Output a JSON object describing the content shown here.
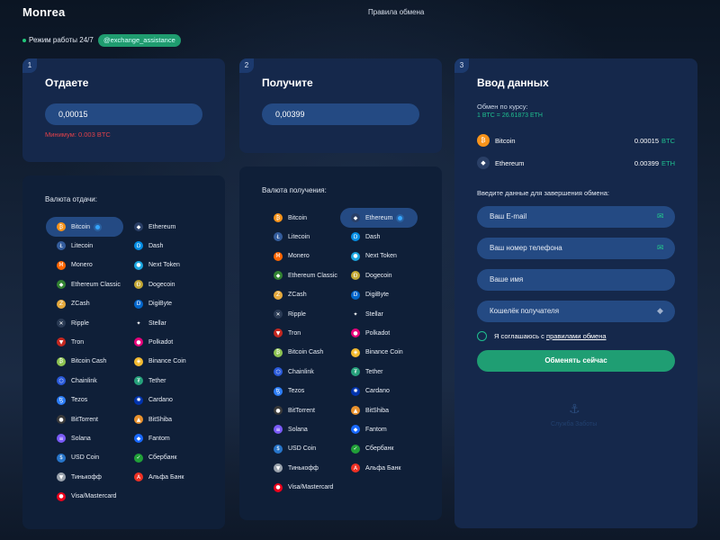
{
  "header": {
    "brand": "Monrea",
    "nav": "Правила обмена"
  },
  "status": {
    "text": "Режим работы 24/7",
    "telegram": "@exchange_assistance"
  },
  "give": {
    "step": "1",
    "title": "Отдаете",
    "amount": "0,00015",
    "minimum": "Минимум: 0.003 BTC",
    "list_title": "Валюта отдачи:",
    "selected": "Bitcoin"
  },
  "get": {
    "step": "2",
    "title": "Получите",
    "amount": "0,00399",
    "list_title": "Валюта получения:",
    "selected": "Ethereum"
  },
  "coins": [
    {
      "name": "Bitcoin",
      "color": "#f7931a",
      "glyph": "₿"
    },
    {
      "name": "Ethereum",
      "color": "#2a3f66",
      "glyph": "◆"
    },
    {
      "name": "Litecoin",
      "color": "#345d9d",
      "glyph": "Ł"
    },
    {
      "name": "Dash",
      "color": "#008de4",
      "glyph": "D"
    },
    {
      "name": "Monero",
      "color": "#ff6600",
      "glyph": "M"
    },
    {
      "name": "Next Token",
      "color": "#1ba6e0",
      "glyph": "●"
    },
    {
      "name": "Ethereum Classic",
      "color": "#328332",
      "glyph": "◆"
    },
    {
      "name": "Dogecoin",
      "color": "#c2a633",
      "glyph": "Ð"
    },
    {
      "name": "ZCash",
      "color": "#e5a93d",
      "glyph": "Z"
    },
    {
      "name": "DigiByte",
      "color": "#0066cc",
      "glyph": "D"
    },
    {
      "name": "Ripple",
      "color": "#2a3b55",
      "glyph": "✕"
    },
    {
      "name": "Stellar",
      "color": "#0f1f38",
      "glyph": "✦"
    },
    {
      "name": "Tron",
      "color": "#c4271f",
      "glyph": "▼"
    },
    {
      "name": "Polkadot",
      "color": "#e6007a",
      "glyph": "●"
    },
    {
      "name": "Bitcoin Cash",
      "color": "#8dc351",
      "glyph": "₿"
    },
    {
      "name": "Binance Coin",
      "color": "#f3ba2f",
      "glyph": "◈"
    },
    {
      "name": "Chainlink",
      "color": "#2a5ada",
      "glyph": "⬡"
    },
    {
      "name": "Tether",
      "color": "#26a17b",
      "glyph": "₮"
    },
    {
      "name": "Tezos",
      "color": "#2c7df7",
      "glyph": "ꜩ"
    },
    {
      "name": "Cardano",
      "color": "#0033ad",
      "glyph": "✺"
    },
    {
      "name": "BitTorrent",
      "color": "#3a3a3a",
      "glyph": "●"
    },
    {
      "name": "BitShiba",
      "color": "#e8912d",
      "glyph": "▲"
    },
    {
      "name": "Solana",
      "color": "#7a5af8",
      "glyph": "≡"
    },
    {
      "name": "Fantom",
      "color": "#1969ff",
      "glyph": "◆"
    },
    {
      "name": "USD Coin",
      "color": "#2775ca",
      "glyph": "$"
    },
    {
      "name": "Сбербанк",
      "color": "#21a038",
      "glyph": "✓"
    },
    {
      "name": "Тинькофф",
      "color": "#9aa3ad",
      "glyph": "▼"
    },
    {
      "name": "Альфа Банк",
      "color": "#ef3124",
      "glyph": "A"
    },
    {
      "name": "Visa/Mastercard",
      "color": "#eb001b",
      "glyph": "●"
    }
  ],
  "data_entry": {
    "step": "3",
    "title": "Ввод данных",
    "rate_label": "Обмен по курсу:",
    "rate_value": "1 BTC = 26.61873 ETH",
    "summary": [
      {
        "name": "Bitcoin",
        "amount": "0.00015",
        "currency": "BTC",
        "color": "#f7931a",
        "glyph": "₿"
      },
      {
        "name": "Ethereum",
        "amount": "0.00399",
        "currency": "ETH",
        "color": "#2a3f66",
        "glyph": "◆"
      }
    ],
    "form_hint": "Введите данные для завершения обмена:",
    "fields": [
      {
        "placeholder": "Ваш E-mail",
        "icon": "✉"
      },
      {
        "placeholder": "Ваш номер телефона",
        "icon": "✉"
      },
      {
        "placeholder": "Ваше имя",
        "icon": ""
      },
      {
        "placeholder": "Кошелёк получателя",
        "icon": "◆"
      }
    ],
    "agree_text": "Я соглашаюсь с ",
    "agree_link": "правилами обмена",
    "submit": "Обменять сейчас",
    "support_text": "Служба Заботы"
  }
}
